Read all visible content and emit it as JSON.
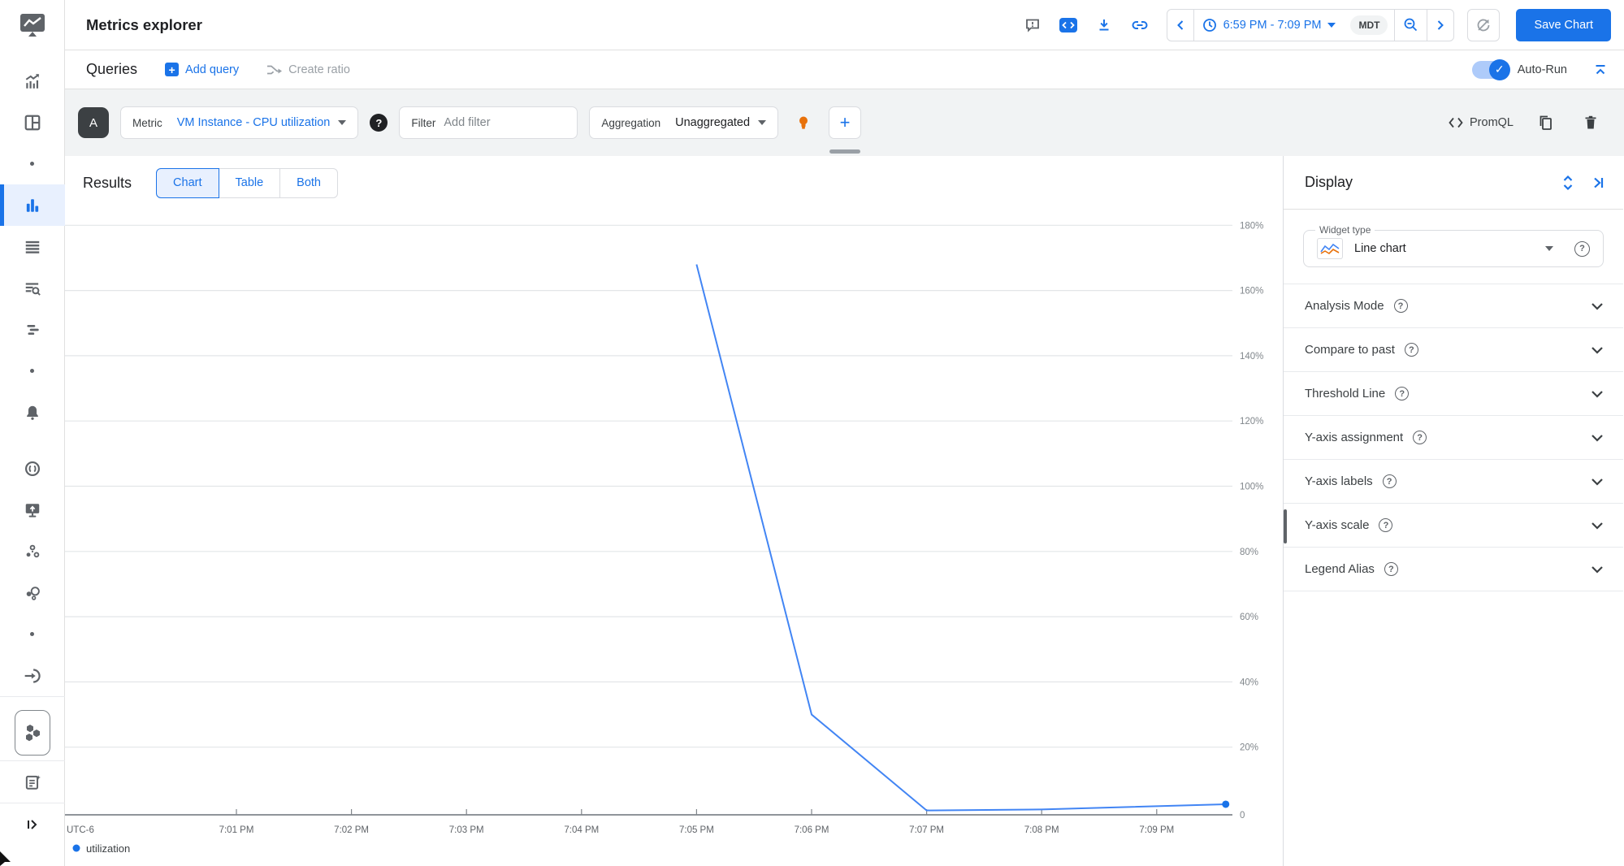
{
  "colors": {
    "accent": "#1a73e8",
    "line_stroke": "#4285f4",
    "bulb_orange": "#e8710a",
    "strip_bg": "#f1f3f4",
    "selected_tab_bg": "#e8f0fe"
  },
  "header": {
    "title": "Metrics explorer",
    "time_range": "6:59 PM - 7:09 PM",
    "timezone": "MDT",
    "save_button": "Save Chart",
    "icons": [
      "feedback-icon",
      "code-toggle-icon",
      "download-icon",
      "link-icon",
      "chevron-left-icon",
      "clock-icon",
      "zoom-out-icon",
      "chevron-right-icon",
      "refresh-off-icon"
    ]
  },
  "queries_row": {
    "title": "Queries",
    "add_query": "Add query",
    "create_ratio": "Create ratio",
    "auto_run": "Auto-Run"
  },
  "query_builder": {
    "letter": "A",
    "metric_label": "Metric",
    "metric_value": "VM Instance - CPU utilization",
    "filter_label": "Filter",
    "filter_placeholder": "Add filter",
    "aggregation_label": "Aggregation",
    "aggregation_value": "Unaggregated",
    "promql_label": "PromQL",
    "icons": [
      "help-icon",
      "lightbulb-icon",
      "add-icon",
      "code-icon",
      "copy-icon",
      "delete-icon"
    ]
  },
  "results": {
    "title": "Results",
    "tabs": [
      {
        "label": "Chart",
        "selected": true
      },
      {
        "label": "Table",
        "selected": false
      },
      {
        "label": "Both",
        "selected": false
      }
    ]
  },
  "chart_data": {
    "type": "line",
    "title": "",
    "x_ticks": [
      "7:01 PM",
      "7:02 PM",
      "7:03 PM",
      "7:04 PM",
      "7:05 PM",
      "7:06 PM",
      "7:07 PM",
      "7:08 PM",
      "7:09 PM"
    ],
    "y_ticks": [
      "180%",
      "160%",
      "140%",
      "120%",
      "100%",
      "80%",
      "60%",
      "40%",
      "20%",
      "0"
    ],
    "ylim": [
      0,
      180
    ],
    "x_axis_note": "UTC-6",
    "grid": "horizontal",
    "legend_position": "bottom-left",
    "series": [
      {
        "name": "utilization",
        "color": "#4285f4",
        "marker_color": "#1a73e8",
        "points": [
          [
            "7:05:00 PM",
            168
          ],
          [
            "7:06:00 PM",
            30
          ],
          [
            "7:07:00 PM",
            0.6
          ],
          [
            "7:08:00 PM",
            0.9
          ],
          [
            "7:09:36 PM",
            2.5
          ]
        ]
      }
    ]
  },
  "display_panel": {
    "title": "Display",
    "widget_type_label": "Widget type",
    "widget_type_value": "Line chart",
    "sections": [
      "Analysis Mode",
      "Compare to past",
      "Threshold Line",
      "Y-axis assignment",
      "Y-axis labels",
      "Y-axis scale",
      "Legend Alias"
    ],
    "icons": [
      "unfold-more-icon",
      "collapse-right-icon",
      "help-icon",
      "chevron-down-icon"
    ]
  },
  "sidebar": {
    "icons": [
      "metrics-logo",
      "monitoring-overview-icon",
      "dashboards-icon",
      "dot",
      "metrics-explorer-icon",
      "logs-icon",
      "logs-analytics-icon",
      "trace-icon",
      "dot",
      "alerting-icon",
      "error-reporting-icon",
      "uptime-monitor-icon",
      "services-icon",
      "profiler-icon",
      "dot",
      "integration-icon",
      "kubernetes-hexagons-icon",
      "release-notes-icon",
      "expand-panel-icon"
    ],
    "active_item": "metrics-explorer"
  }
}
